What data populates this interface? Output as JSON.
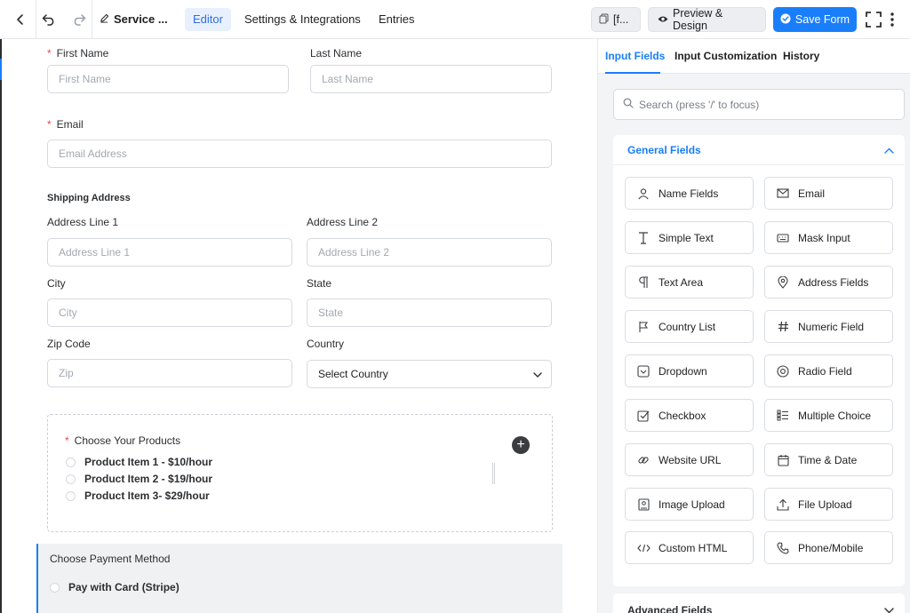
{
  "topbar": {
    "form_title": "Service ...",
    "tabs": [
      {
        "label": "Editor"
      },
      {
        "label": "Settings & Integrations"
      },
      {
        "label": "Entries"
      }
    ],
    "shortcode_label": "[f...",
    "preview_label": "Preview & Design",
    "save_label": "Save Form",
    "accent_color": "#1a7efb"
  },
  "form": {
    "first_name": {
      "label": "First Name",
      "placeholder": "First Name"
    },
    "last_name": {
      "label": "Last Name",
      "placeholder": "Last Name"
    },
    "email": {
      "label": "Email",
      "placeholder": "Email Address"
    },
    "shipping": {
      "title": "Shipping Address",
      "address1": {
        "label": "Address Line 1",
        "placeholder": "Address Line 1"
      },
      "address2": {
        "label": "Address Line 2",
        "placeholder": "Address Line 2"
      },
      "city": {
        "label": "City",
        "placeholder": "City"
      },
      "state": {
        "label": "State",
        "placeholder": "State"
      },
      "zip": {
        "label": "Zip Code",
        "placeholder": "Zip"
      },
      "country": {
        "label": "Country",
        "value": "Select Country"
      }
    },
    "products": {
      "label": "Choose Your Products",
      "items": [
        {
          "label": "Product Item 1 - $10/hour"
        },
        {
          "label": "Product Item 2 - $19/hour"
        },
        {
          "label": "Product Item 3- $29/hour"
        }
      ]
    },
    "payment": {
      "label": "Choose Payment Method",
      "options": [
        {
          "label": "Pay with Card (Stripe)"
        }
      ]
    }
  },
  "panel": {
    "tabs": [
      {
        "label": "Input Fields"
      },
      {
        "label": "Input Customization"
      },
      {
        "label": "History"
      }
    ],
    "search_placeholder": "Search (press '/' to focus)",
    "general_title": "General Fields",
    "advanced_title": "Advanced Fields",
    "fields": [
      {
        "label": "Name Fields",
        "icon": "person-icon"
      },
      {
        "label": "Email",
        "icon": "envelope-icon"
      },
      {
        "label": "Simple Text",
        "icon": "text-cursor-icon"
      },
      {
        "label": "Mask Input",
        "icon": "keyboard-icon"
      },
      {
        "label": "Text Area",
        "icon": "paragraph-icon"
      },
      {
        "label": "Address Fields",
        "icon": "map-pin-icon"
      },
      {
        "label": "Country List",
        "icon": "flag-icon"
      },
      {
        "label": "Numeric Field",
        "icon": "hash-icon"
      },
      {
        "label": "Dropdown",
        "icon": "dropdown-icon"
      },
      {
        "label": "Radio Field",
        "icon": "radio-icon"
      },
      {
        "label": "Checkbox",
        "icon": "checkbox-icon"
      },
      {
        "label": "Multiple Choice",
        "icon": "list-icon"
      },
      {
        "label": "Website URL",
        "icon": "link-icon"
      },
      {
        "label": "Time & Date",
        "icon": "calendar-icon"
      },
      {
        "label": "Image Upload",
        "icon": "image-icon"
      },
      {
        "label": "File Upload",
        "icon": "upload-icon"
      },
      {
        "label": "Custom HTML",
        "icon": "code-icon"
      },
      {
        "label": "Phone/Mobile",
        "icon": "phone-icon"
      }
    ]
  }
}
